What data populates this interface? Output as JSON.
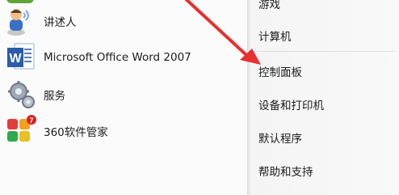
{
  "programs": [
    {
      "label": "讲述人",
      "icon": "narrator-icon"
    },
    {
      "label": "Microsoft Office Word 2007",
      "icon": "word-icon"
    },
    {
      "label": "服务",
      "icon": "services-icon"
    },
    {
      "label": "360软件管家",
      "icon": "360-software-manager-icon",
      "badge": "7"
    }
  ],
  "system_links": [
    {
      "label": "游戏"
    },
    {
      "label": "计算机"
    },
    {
      "label": "控制面板"
    },
    {
      "label": "设备和打印机"
    },
    {
      "label": "默认程序"
    },
    {
      "label": "帮助和支持"
    }
  ],
  "colors": {
    "annotation_arrow": "#e8302f"
  }
}
